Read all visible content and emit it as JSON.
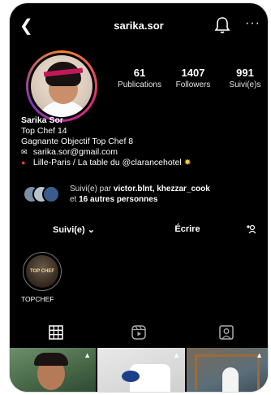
{
  "header": {
    "username": "sarika.sor",
    "back_icon": "chevron-left-icon",
    "notification_icon": "bell-icon",
    "more_icon": "more-horizontal-icon",
    "more_label": "···"
  },
  "stats": [
    {
      "value": "61",
      "label": "Publications"
    },
    {
      "value": "1407",
      "label": "Followers"
    },
    {
      "value": "991",
      "label": "Suivi(e)s"
    }
  ],
  "bio": {
    "name": "Sarika Sor",
    "line1": "Top Chef 14",
    "line2": "Gagnante Objectif Top Chef 8",
    "email": "sarika.sor@gmail.com",
    "location": "Lille-Paris / La table du @clarancehotel"
  },
  "followed_by": {
    "prefix": "Suivi(e) par ",
    "names": "victor.blnt, khezzar_cook",
    "suffix_prefix": "et ",
    "others": "16 autres personnes"
  },
  "actions": {
    "follow_label": "Suivi(e) ⌄",
    "message_label": "Écrire",
    "add_user_label": "+ዴ"
  },
  "highlights": [
    {
      "label": "TOPCHEF",
      "cover_text": "TOP CHEF"
    }
  ],
  "tabs": [
    "grid-icon",
    "reels-icon",
    "tagged-icon"
  ],
  "colors": {
    "background": "#000000",
    "story_ring": [
      "#f58529",
      "#dd2a7b",
      "#8134af"
    ]
  }
}
